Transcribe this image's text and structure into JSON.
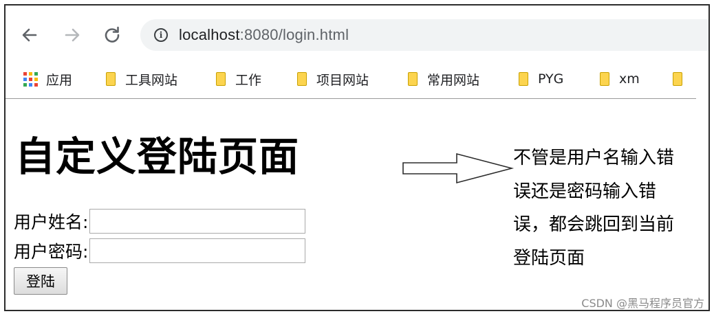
{
  "browser": {
    "url_host": "localhost",
    "url_rest": ":8080/login.html"
  },
  "bookmarks": [
    {
      "label": "应用",
      "icon": "apps-grid-icon"
    },
    {
      "label": "工具网站",
      "icon": "folder-icon"
    },
    {
      "label": "工作",
      "icon": "folder-icon"
    },
    {
      "label": "项目网站",
      "icon": "folder-icon"
    },
    {
      "label": "常用网站",
      "icon": "folder-icon"
    },
    {
      "label": "PYG",
      "icon": "folder-icon"
    },
    {
      "label": "xm",
      "icon": "folder-icon"
    },
    {
      "label": "",
      "icon": "folder-icon"
    }
  ],
  "page": {
    "title": "自定义登陆页面",
    "username_label": "用户姓名:",
    "username_value": "",
    "password_label": "用户密码:",
    "password_value": "",
    "login_label": "登陆"
  },
  "annotation": {
    "lines": [
      "不管是用户名输入错",
      "误还是密码输入错",
      "误，都会跳回到当前",
      "登陆页面"
    ]
  },
  "watermark": "CSDN @黑马程序员官方",
  "colors": {
    "omnibox_bg": "#f1f3f4",
    "folder": "#fcd44f"
  }
}
